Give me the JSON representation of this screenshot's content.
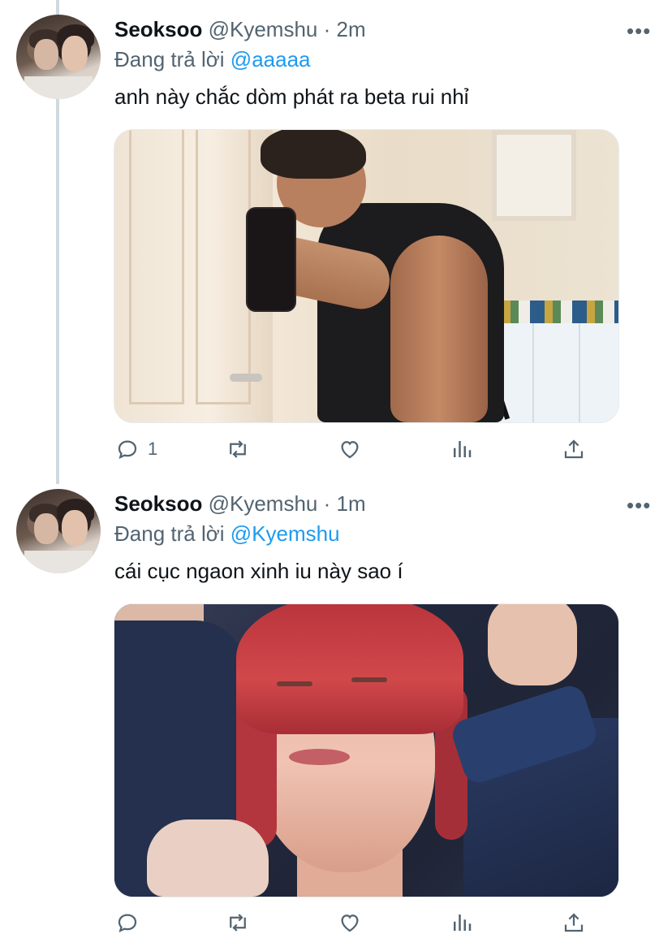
{
  "tweets": [
    {
      "name": "Seoksoo",
      "handle": "@Kyemshu",
      "separator": "·",
      "time": "2m",
      "reply_prefix": "Đang trả lời",
      "reply_to": "@aaaaa",
      "text": "anh này chắc dòm phát ra beta rui nhỉ",
      "more": "•••",
      "media_icon": "photo-mirror-selfie",
      "actions": {
        "reply_count": "1",
        "retweet_count": "",
        "like_count": ""
      }
    },
    {
      "name": "Seoksoo",
      "handle": "@Kyemshu",
      "separator": "·",
      "time": "1m",
      "reply_prefix": "Đang trả lời",
      "reply_to": "@Kyemshu",
      "text": "cái cục ngaon xinh iu này sao í",
      "more": "•••",
      "media_icon": "photo-red-hair-portrait",
      "actions": {
        "reply_count": "",
        "retweet_count": "",
        "like_count": ""
      }
    }
  ],
  "colors": {
    "accent": "#1d9bf0",
    "muted": "#536471",
    "text": "#0f1419",
    "thread_line": "#cfd9de"
  }
}
